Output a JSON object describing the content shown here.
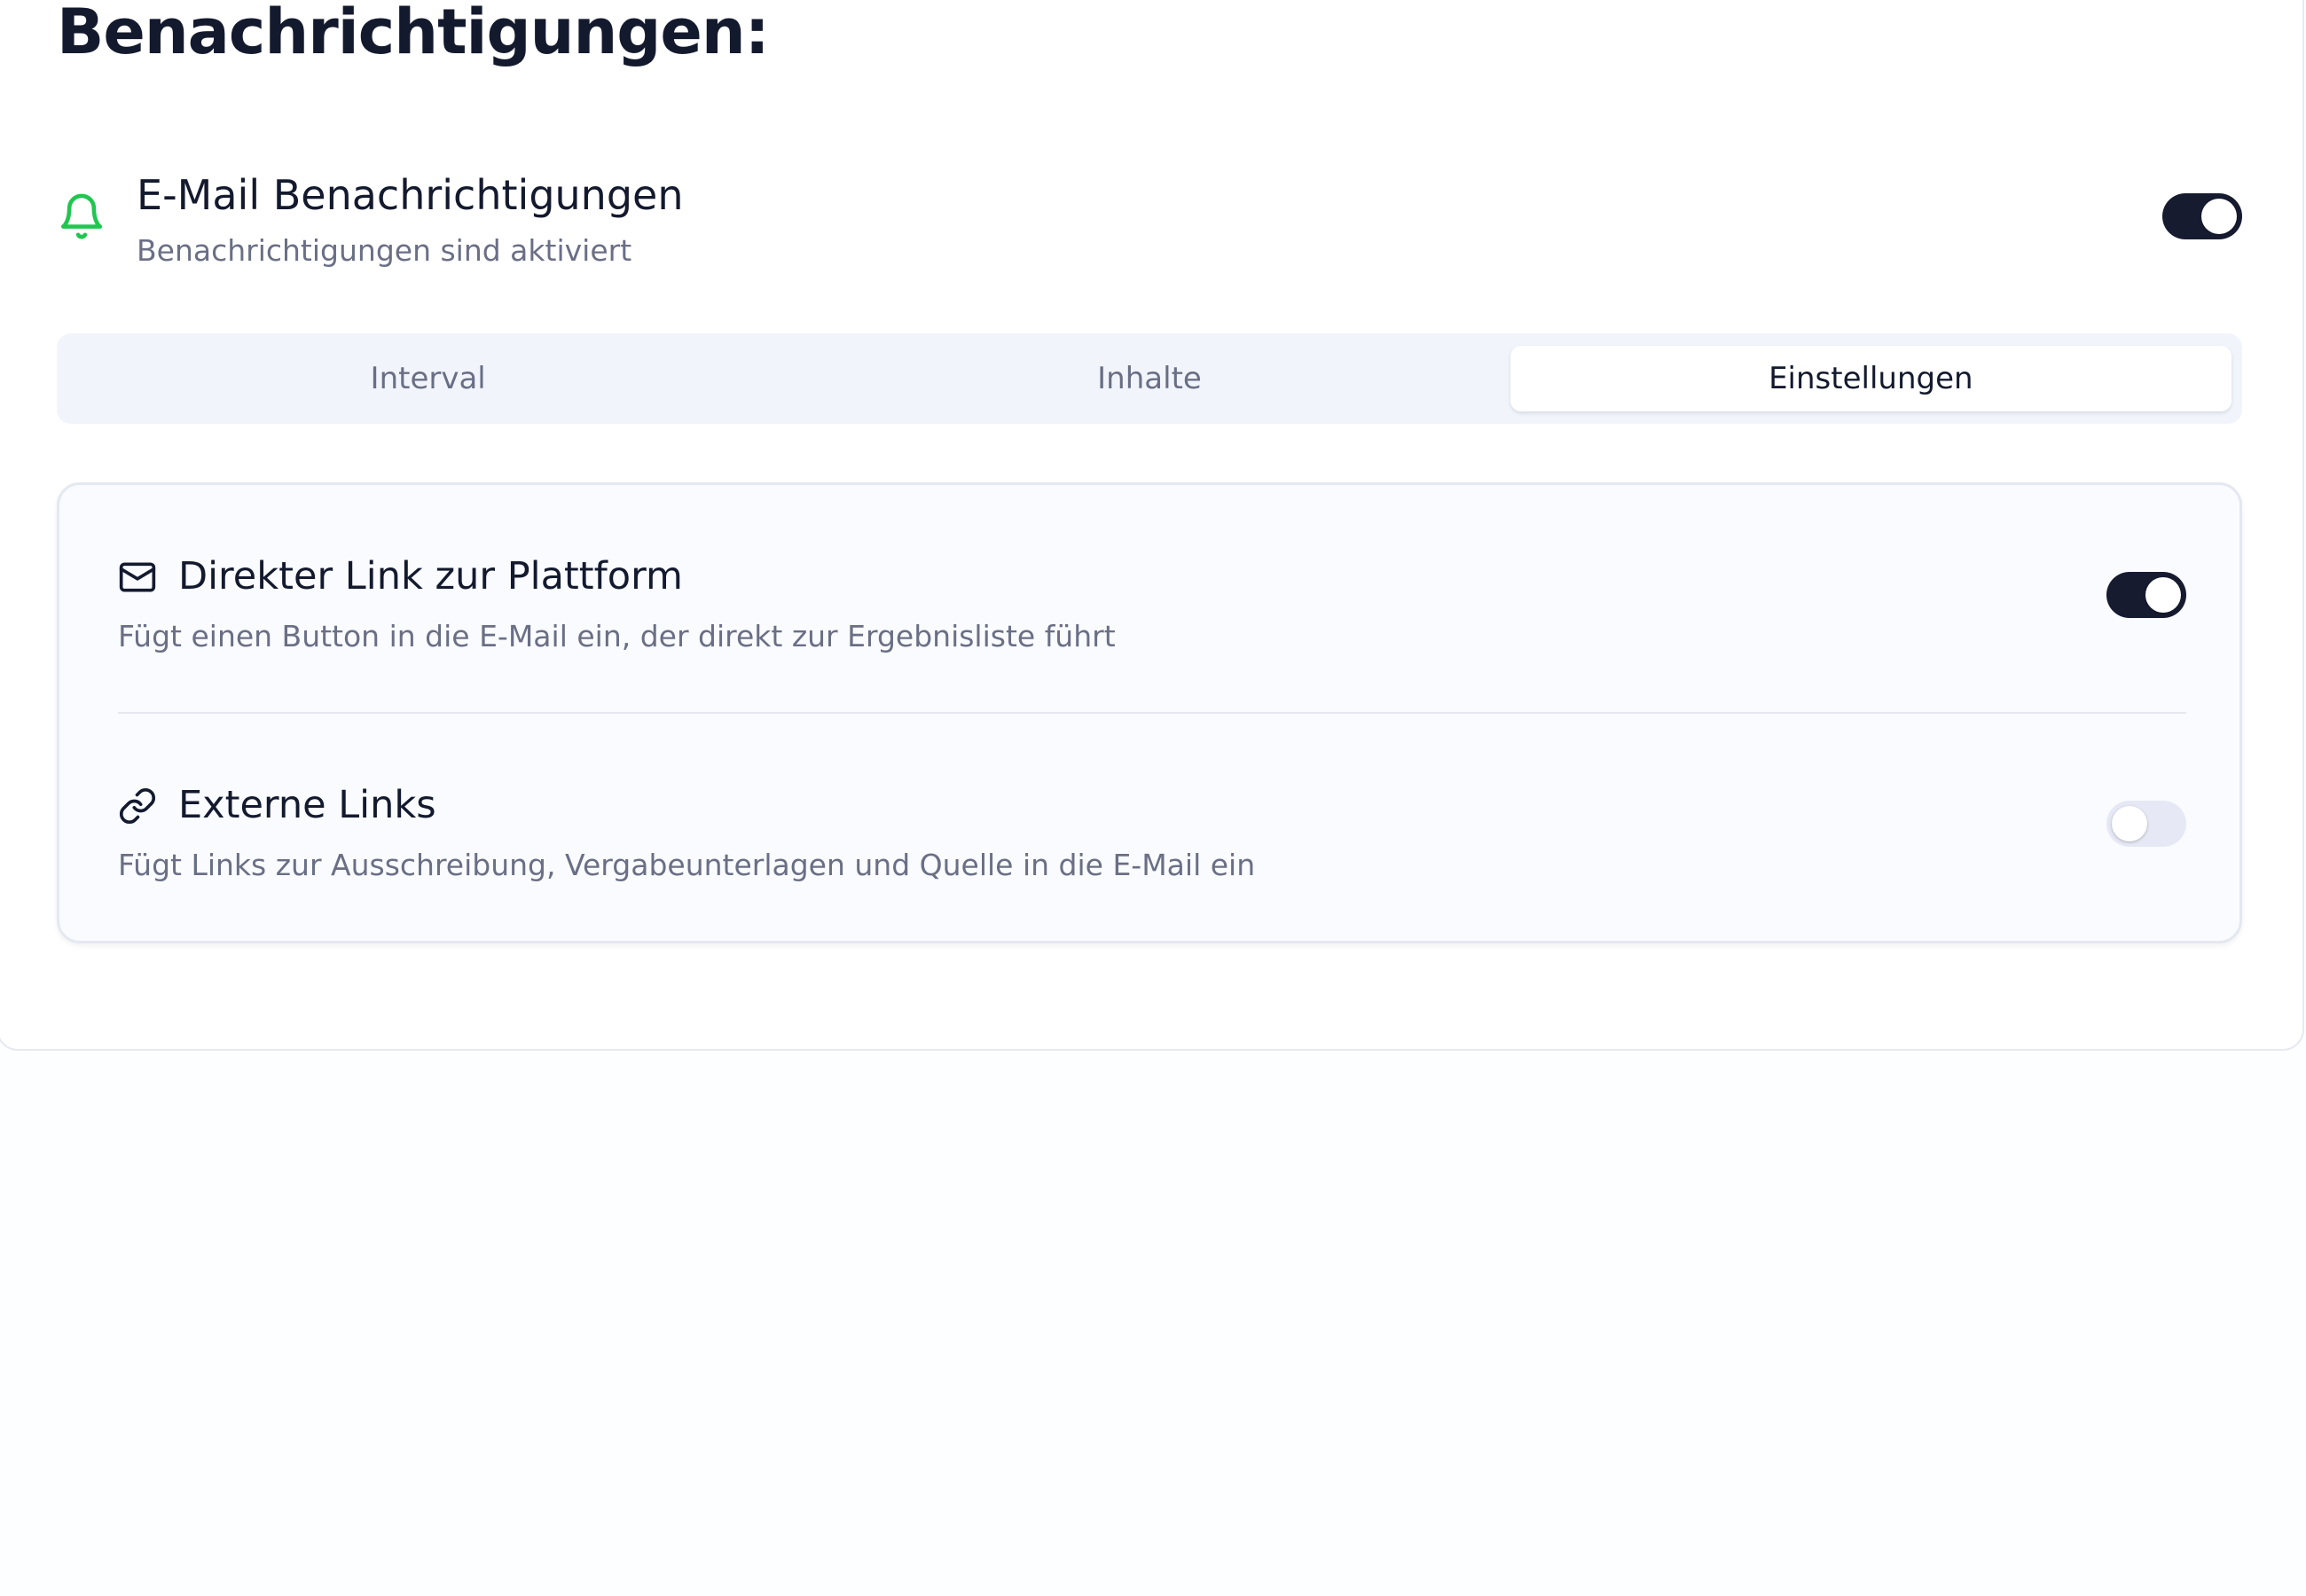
{
  "page": {
    "title": "Benachrichtigungen:"
  },
  "email_notifications": {
    "title": "E-Mail Benachrichtigungen",
    "status": "Benachrichtigungen sind aktiviert",
    "enabled": true,
    "icon": "bell-icon",
    "icon_color": "#1fc74f"
  },
  "tabs": [
    {
      "label": "Interval",
      "active": false
    },
    {
      "label": "Inhalte",
      "active": false
    },
    {
      "label": "Einstellungen",
      "active": true
    }
  ],
  "settings": [
    {
      "icon": "mail-icon",
      "title": "Direkter Link zur Plattform",
      "description": "Fügt einen Button in die E-Mail ein, der direkt zur Ergebnisliste führt",
      "enabled": true
    },
    {
      "icon": "link-icon",
      "title": "Externe Links",
      "description": "Fügt Links zur Ausschreibung, Vergabeunterlagen und Quelle in die E-Mail ein",
      "enabled": false
    }
  ],
  "colors": {
    "toggle_on": "#171b30",
    "toggle_off": "#e6e9f5",
    "accent_green": "#1fc74f"
  }
}
